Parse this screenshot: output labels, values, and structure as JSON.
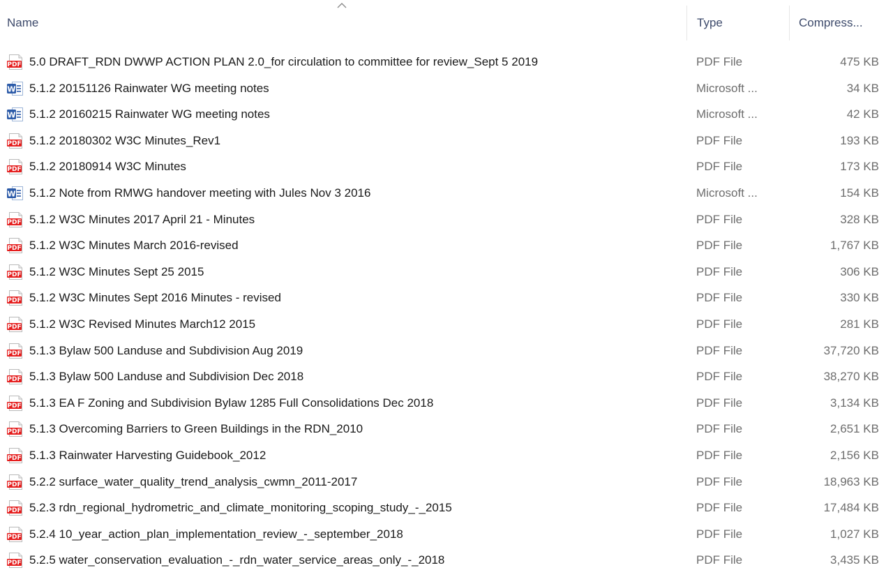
{
  "header": {
    "name_label": "Name",
    "type_label": "Type",
    "size_label": "Compress...",
    "sorted_column": "name",
    "sort_direction": "ascending"
  },
  "icons": {
    "pdf": {
      "name": "pdf-file-icon",
      "label": "PDF",
      "color": "#e51d1d"
    },
    "word": {
      "name": "word-document-icon",
      "label": "W",
      "color": "#2b5aa8"
    }
  },
  "files": [
    {
      "icon": "pdf",
      "name": "5.0 DRAFT_RDN DWWP ACTION PLAN 2.0_for circulation to committee for review_Sept 5 2019",
      "type": "PDF File",
      "size": "475 KB"
    },
    {
      "icon": "word",
      "name": "5.1.2 20151126 Rainwater WG meeting notes",
      "type": "Microsoft ...",
      "size": "34 KB"
    },
    {
      "icon": "word",
      "name": "5.1.2 20160215 Rainwater WG meeting notes",
      "type": "Microsoft ...",
      "size": "42 KB"
    },
    {
      "icon": "pdf",
      "name": "5.1.2 20180302 W3C Minutes_Rev1",
      "type": "PDF File",
      "size": "193 KB"
    },
    {
      "icon": "pdf",
      "name": "5.1.2 20180914 W3C Minutes",
      "type": "PDF File",
      "size": "173 KB"
    },
    {
      "icon": "word",
      "name": "5.1.2 Note from RMWG handover meeting with Jules Nov 3 2016",
      "type": "Microsoft ...",
      "size": "154 KB"
    },
    {
      "icon": "pdf",
      "name": "5.1.2 W3C Minutes 2017 April 21 - Minutes",
      "type": "PDF File",
      "size": "328 KB"
    },
    {
      "icon": "pdf",
      "name": "5.1.2 W3C Minutes March 2016-revised",
      "type": "PDF File",
      "size": "1,767 KB"
    },
    {
      "icon": "pdf",
      "name": "5.1.2 W3C Minutes Sept 25 2015",
      "type": "PDF File",
      "size": "306 KB"
    },
    {
      "icon": "pdf",
      "name": "5.1.2 W3C Minutes Sept 2016 Minutes - revised",
      "type": "PDF File",
      "size": "330 KB"
    },
    {
      "icon": "pdf",
      "name": "5.1.2 W3C Revised Minutes March12 2015",
      "type": "PDF File",
      "size": "281 KB"
    },
    {
      "icon": "pdf",
      "name": "5.1.3 Bylaw 500 Landuse and Subdivision Aug 2019",
      "type": "PDF File",
      "size": "37,720 KB"
    },
    {
      "icon": "pdf",
      "name": "5.1.3 Bylaw 500 Landuse and Subdivision Dec 2018",
      "type": "PDF File",
      "size": "38,270 KB"
    },
    {
      "icon": "pdf",
      "name": "5.1.3 EA F Zoning and Subdivision Bylaw 1285 Full Consolidations Dec 2018",
      "type": "PDF File",
      "size": "3,134 KB"
    },
    {
      "icon": "pdf",
      "name": "5.1.3 Overcoming Barriers to Green Buildings in the RDN_2010",
      "type": "PDF File",
      "size": "2,651 KB"
    },
    {
      "icon": "pdf",
      "name": "5.1.3 Rainwater Harvesting Guidebook_2012",
      "type": "PDF File",
      "size": "2,156 KB"
    },
    {
      "icon": "pdf",
      "name": "5.2.2 surface_water_quality_trend_analysis_cwmn_2011-2017",
      "type": "PDF File",
      "size": "18,963 KB"
    },
    {
      "icon": "pdf",
      "name": "5.2.3 rdn_regional_hydrometric_and_climate_monitoring_scoping_study_-_2015",
      "type": "PDF File",
      "size": "17,484 KB"
    },
    {
      "icon": "pdf",
      "name": "5.2.4 10_year_action_plan_implementation_review_-_september_2018",
      "type": "PDF File",
      "size": "1,027 KB"
    },
    {
      "icon": "pdf",
      "name": "5.2.5 water_conservation_evaluation_-_rdn_water_service_areas_only_-_2018",
      "type": "PDF File",
      "size": "3,435 KB"
    }
  ]
}
